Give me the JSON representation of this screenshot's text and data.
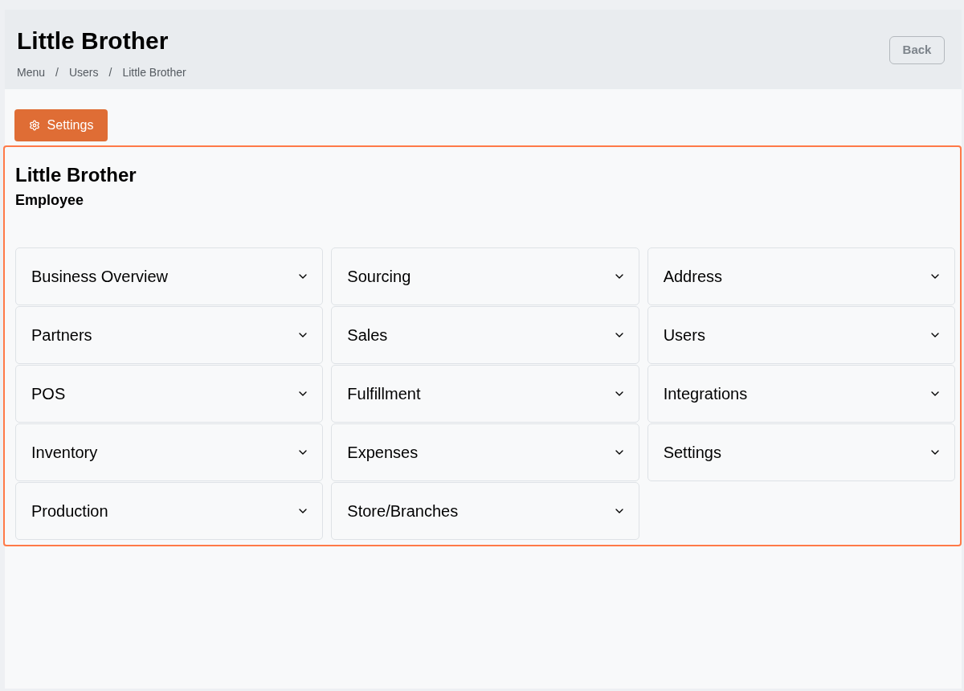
{
  "header": {
    "title": "Little Brother",
    "breadcrumb": [
      {
        "kind": "link",
        "text": "Menu"
      },
      {
        "kind": "separator",
        "text": "/"
      },
      {
        "kind": "link",
        "text": "Users"
      },
      {
        "kind": "separator",
        "text": "/"
      },
      {
        "kind": "current",
        "text": "Little Brother"
      }
    ],
    "back_button": "Back"
  },
  "settings_button": {
    "label": "Settings"
  },
  "card": {
    "title": "Little Brother",
    "role": "Employee",
    "columns": [
      {
        "sections": [
          {
            "label": "Business Overview",
            "expanded": false
          },
          {
            "label": "Partners",
            "expanded": false
          },
          {
            "label": "POS",
            "expanded": false
          },
          {
            "label": "Inventory",
            "expanded": false
          },
          {
            "label": "Production",
            "expanded": false
          }
        ]
      },
      {
        "sections": [
          {
            "label": "Sourcing",
            "expanded": false
          },
          {
            "label": "Sales",
            "expanded": false
          },
          {
            "label": "Fulfillment",
            "expanded": false
          },
          {
            "label": "Expenses",
            "expanded": false
          },
          {
            "label": "Store/Branches",
            "expanded": false
          }
        ]
      },
      {
        "sections": [
          {
            "label": "Address",
            "expanded": false
          },
          {
            "label": "Users",
            "expanded": false
          },
          {
            "label": "Integrations",
            "expanded": false
          },
          {
            "label": "Settings",
            "expanded": false
          }
        ]
      }
    ]
  }
}
